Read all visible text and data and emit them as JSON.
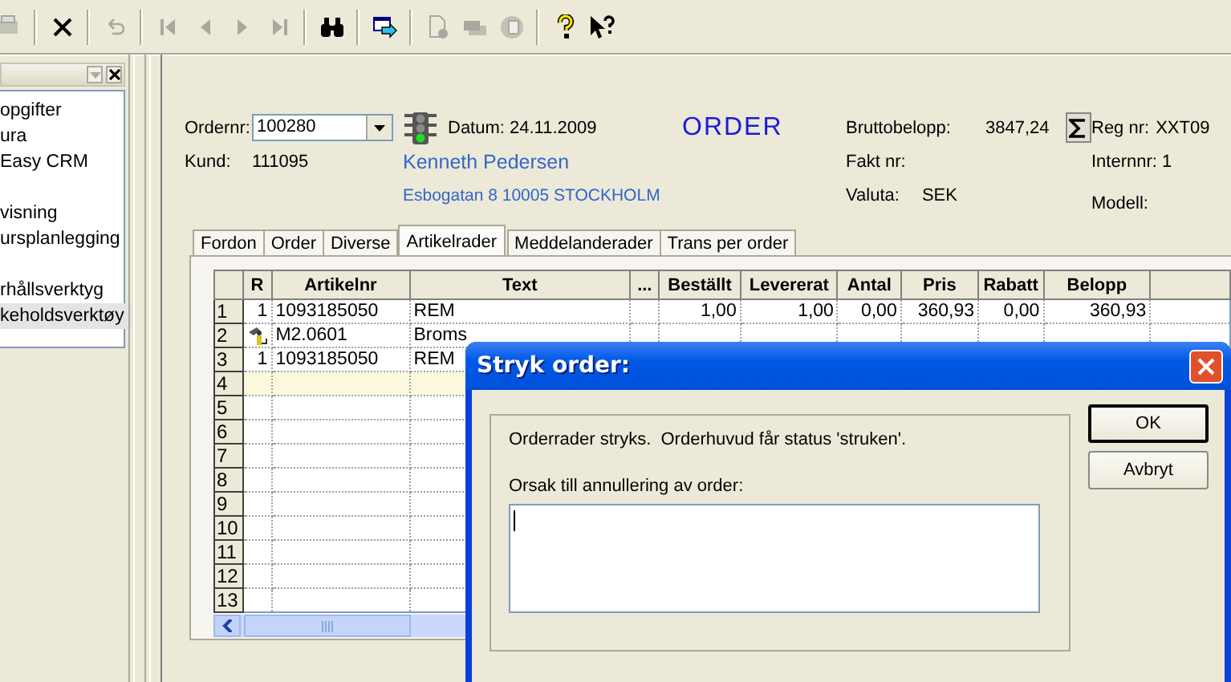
{
  "toolbar": [
    {
      "kind": "print",
      "disabled": true
    },
    {
      "kind": "sep"
    },
    {
      "kind": "delete",
      "disabled": false
    },
    {
      "kind": "sep"
    },
    {
      "kind": "undo",
      "disabled": true
    },
    {
      "kind": "sep"
    },
    {
      "kind": "first",
      "disabled": true
    },
    {
      "kind": "prev",
      "disabled": true
    },
    {
      "kind": "next",
      "disabled": true
    },
    {
      "kind": "last",
      "disabled": true
    },
    {
      "kind": "sep"
    },
    {
      "kind": "find",
      "disabled": false
    },
    {
      "kind": "sep"
    },
    {
      "kind": "transfer",
      "disabled": false
    },
    {
      "kind": "sep"
    },
    {
      "kind": "newdoc",
      "disabled": true
    },
    {
      "kind": "stack",
      "disabled": true
    },
    {
      "kind": "copy",
      "disabled": true
    },
    {
      "kind": "sep"
    },
    {
      "kind": "help",
      "disabled": false
    },
    {
      "kind": "whatsthis",
      "disabled": false
    }
  ],
  "sidebar": {
    "items": [
      {
        "label": "opgifter",
        "selected": false
      },
      {
        "label": "ura",
        "selected": false
      },
      {
        "label": "Easy CRM",
        "selected": false
      },
      {
        "label": "visning",
        "selected": false
      },
      {
        "label": "ursplanlegging",
        "selected": false
      },
      {
        "label": "rhållsverktyg",
        "selected": false
      },
      {
        "label": "keholdsverktøy",
        "selected": true
      }
    ]
  },
  "order_form": {
    "ordernr_label": "Ordernr:",
    "ordernr": "100280",
    "signal_lamps": [
      {
        "on": false
      },
      {
        "on": false
      },
      {
        "on": true
      }
    ],
    "datum": "Datum: 24.11.2009",
    "title": "ORDER",
    "brutto_label": "Bruttobelopp:",
    "brutto": "3847,24",
    "reg_label": "Reg nr:",
    "reg": "XXT09",
    "kund_label": "Kund:",
    "kund": "111095",
    "customer_name": "Kenneth Pedersen",
    "customer_address": "Esbogatan 8 10005 STOCKHOLM",
    "fakt_label": "Fakt nr:",
    "internnr": "Internnr: 1",
    "valuta_label": "Valuta:",
    "valuta": "SEK",
    "modell_label": "Modell:"
  },
  "tabs": [
    {
      "label": "Fordon",
      "selected": false
    },
    {
      "label": "Order",
      "selected": false
    },
    {
      "label": "Diverse",
      "selected": false
    },
    {
      "label": "Artikelrader",
      "selected": true
    },
    {
      "label": "Meddelanderader",
      "selected": false
    },
    {
      "label": "Trans per order",
      "selected": false
    }
  ],
  "table": {
    "columns": [
      "R",
      "Artikelnr",
      "Text",
      "...",
      "Beställt",
      "Levererat",
      "Antal",
      "Pris",
      "Rabatt",
      "Belopp"
    ],
    "rows": [
      {
        "row": "1",
        "r": "1",
        "flagged": false,
        "artikelnr": "1093185050",
        "text": "REM",
        "bestallt": "1,00",
        "levererat": "1,00",
        "antal": "0,00",
        "pris": "360,93",
        "rabatt": "0,00",
        "belopp": "360,93",
        "selected": false
      },
      {
        "row": "2",
        "flagged": true,
        "artikelnr": "M2.0601",
        "text": "Broms",
        "selected": false
      },
      {
        "row": "3",
        "r": "1",
        "flagged": false,
        "artikelnr": "1093185050",
        "text": "REM",
        "selected": false
      },
      {
        "row": "4",
        "flagged": false,
        "selected": true
      },
      {
        "row": "5",
        "flagged": false,
        "selected": false
      },
      {
        "row": "6",
        "flagged": false,
        "selected": false
      },
      {
        "row": "7",
        "flagged": false,
        "selected": false
      },
      {
        "row": "8",
        "flagged": false,
        "selected": false
      },
      {
        "row": "9",
        "flagged": false,
        "selected": false
      },
      {
        "row": "10",
        "flagged": false,
        "selected": false
      },
      {
        "row": "11",
        "flagged": false,
        "selected": false
      },
      {
        "row": "12",
        "flagged": false,
        "selected": false
      },
      {
        "row": "13",
        "flagged": false,
        "selected": false
      }
    ]
  },
  "dialog": {
    "title": "Stryk order:",
    "message": "Orderrader stryks.  Orderhuvud får status 'struken'.",
    "reason_label": "Orsak till annullering av order:",
    "buttons": [
      {
        "label": "OK",
        "default": true
      },
      {
        "label": "Avbryt",
        "default": false
      }
    ]
  }
}
